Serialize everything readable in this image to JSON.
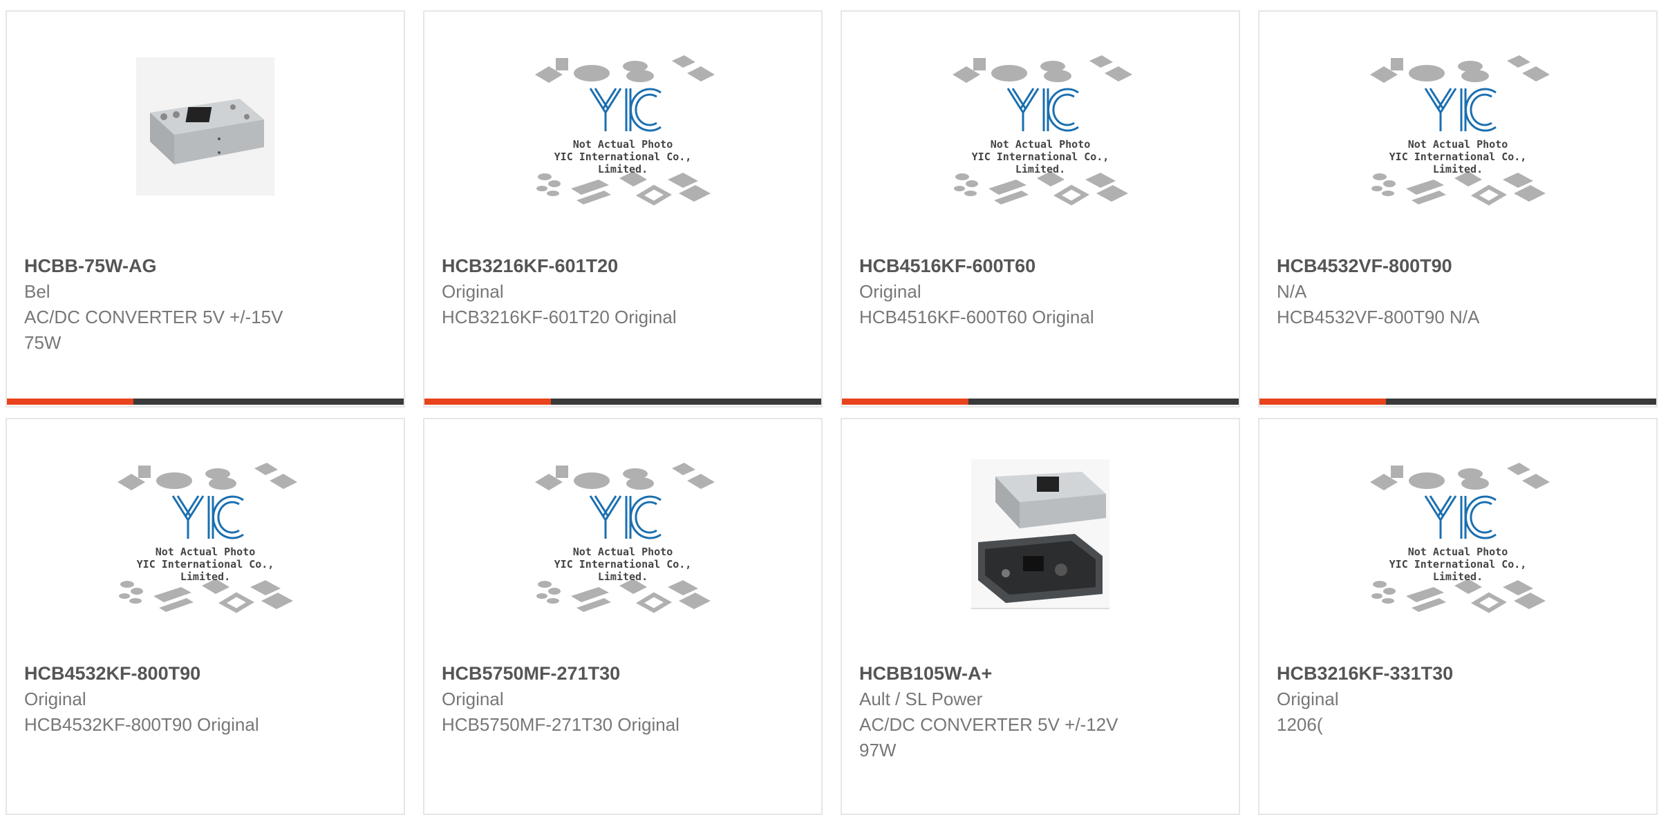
{
  "placeholder": {
    "logo": "YIC",
    "line1": "Not Actual Photo",
    "line2": "YIC International Co., Limited."
  },
  "products": [
    {
      "part": "HCBB-75W-AG",
      "line1": "Bel",
      "line2": "AC/DC CONVERTER 5V +/-15V",
      "line3": "75W",
      "image": "power-supply-photo"
    },
    {
      "part": "HCB3216KF-601T20",
      "line1": "Original",
      "line2": "HCB3216KF-601T20 Original",
      "line3": "",
      "image": "placeholder"
    },
    {
      "part": "HCB4516KF-600T60",
      "line1": "Original",
      "line2": "HCB4516KF-600T60 Original",
      "line3": "",
      "image": "placeholder"
    },
    {
      "part": "HCB4532VF-800T90",
      "line1": "N/A",
      "line2": "HCB4532VF-800T90 N/A",
      "line3": "",
      "image": "placeholder"
    },
    {
      "part": "HCB4532KF-800T90",
      "line1": "Original",
      "line2": "HCB4532KF-800T90 Original",
      "line3": "",
      "image": "placeholder"
    },
    {
      "part": "HCB5750MF-271T30",
      "line1": "Original",
      "line2": "HCB5750MF-271T30 Original",
      "line3": "",
      "image": "placeholder"
    },
    {
      "part": "HCBB105W-A+",
      "line1": "Ault / SL Power",
      "line2": "AC/DC CONVERTER 5V +/-12V",
      "line3": "97W",
      "image": "open-frame-photo"
    },
    {
      "part": "HCB3216KF-331T30",
      "line1": "Original",
      "line2": "1206(",
      "line3": "",
      "image": "placeholder"
    }
  ],
  "colors": {
    "accent": "#e8431c",
    "bar": "#3a3a3a",
    "logo": "#1a6fb0"
  }
}
